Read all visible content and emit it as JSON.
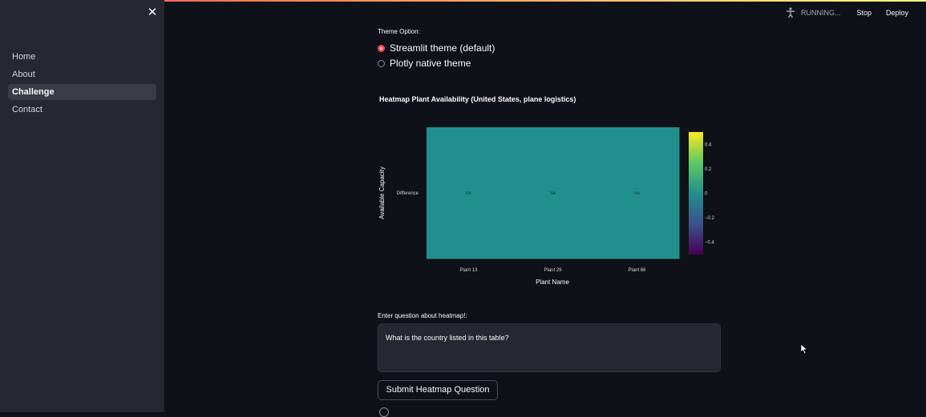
{
  "sidebar": {
    "close_icon": "close-icon",
    "items": [
      {
        "label": "Home",
        "active": false
      },
      {
        "label": "About",
        "active": false
      },
      {
        "label": "Challenge",
        "active": true
      },
      {
        "label": "Contact",
        "active": false
      }
    ]
  },
  "header": {
    "status_icon": "running-person-icon",
    "status_text": "RUNNING...",
    "stop_label": "Stop",
    "deploy_label": "Deploy",
    "menu_icon": "kebab-menu-icon"
  },
  "theme": {
    "label": "Theme Option:",
    "options": [
      {
        "label": "Streamlit theme (default)",
        "selected": true
      },
      {
        "label": "Plotly native theme",
        "selected": false
      }
    ]
  },
  "chart_data": {
    "type": "heatmap",
    "title": "Heatmap Plant Availability (United States, plane logistics)",
    "xlabel": "Plant Name",
    "ylabel": "Available Capacity",
    "x": [
      "Plant 13",
      "Plant 29",
      "Plant 66"
    ],
    "y": [
      "Difference"
    ],
    "z": [
      [
        0,
        0,
        0
      ]
    ],
    "cell_text": [
      "NA",
      "NA",
      "NA"
    ],
    "colorscale": "viridis",
    "colorbar_range": [
      -0.5,
      0.5
    ],
    "colorbar_ticks": [
      "0.4",
      "0.2",
      "0",
      "−0.2",
      "−0.4"
    ],
    "cell_color": "#21908d"
  },
  "question": {
    "label": "Enter question about heatmap!:",
    "value": "What is the country listed in this table?"
  },
  "submit_label": "Submit Heatmap Question",
  "colors": {
    "background": "#0e1117",
    "sidebar": "#262730",
    "accent": "#ff4b4b"
  }
}
